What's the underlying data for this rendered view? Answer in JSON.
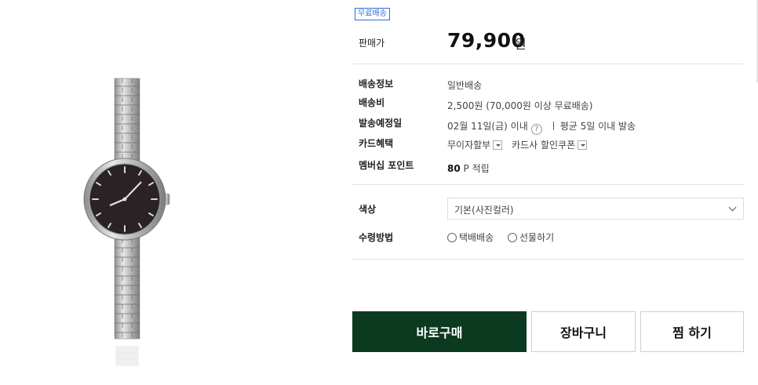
{
  "badge": {
    "free_shipping": "무료배송"
  },
  "price": {
    "label": "판매가",
    "value": "79,900",
    "unit": "원"
  },
  "shipping": {
    "method_label": "배송정보",
    "method_value": "일반배송",
    "fee_label": "배송비",
    "fee_value": "2,500원 (70,000원 이상 무료배송)",
    "date_label": "발송예정일",
    "date_value": "02월 11일(금) 이내",
    "help_glyph": "?",
    "avg_value": "평균 5일 이내 발송",
    "card_label": "카드혜택",
    "card_installment": "무이자할부",
    "card_coupon": "카드사 할인쿠폰",
    "points_label": "멤버십 포인트",
    "points_num": "80",
    "points_suffix": "P 적립"
  },
  "options": {
    "color_label": "색상",
    "color_selected": "기본(사진컬러)",
    "receive_label": "수령방법",
    "receive_options": [
      "택배배송",
      "선물하기"
    ]
  },
  "actions": {
    "buy": "바로구매",
    "cart": "장바구니",
    "wish": "찜 하기"
  },
  "colors": {
    "buy_button": "#0c3a21",
    "badge": "#2f6fd8"
  }
}
